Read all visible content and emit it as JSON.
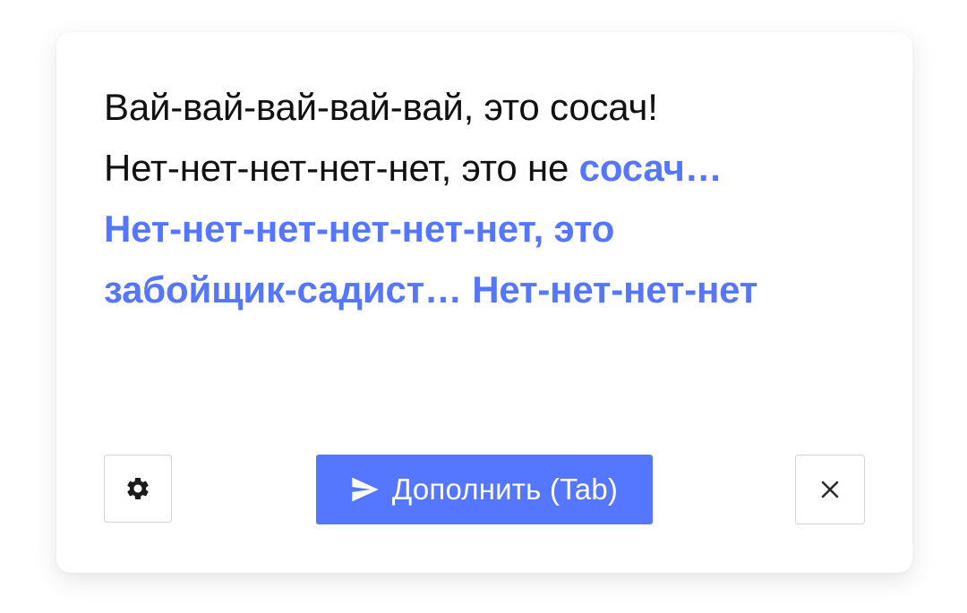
{
  "completion": {
    "line1": "Вай-вай-вай-вай-вай, это сосач!",
    "line2_typed": "Нет-нет-нет-нет-нет, это не ",
    "line2_suggestion": "сосач…",
    "line3_suggestion": "Нет-нет-нет-нет-нет-нет, это",
    "line4_suggestion": "забойщик-садист… Нет-нет-нет-нет"
  },
  "toolbar": {
    "settings_icon": "gear-icon",
    "submit_icon": "send-icon",
    "submit_label": "Дополнить (Tab)",
    "close_icon": "close-icon"
  },
  "colors": {
    "accent": "#5576ff",
    "text": "#111111",
    "border": "#d4d4d4"
  }
}
